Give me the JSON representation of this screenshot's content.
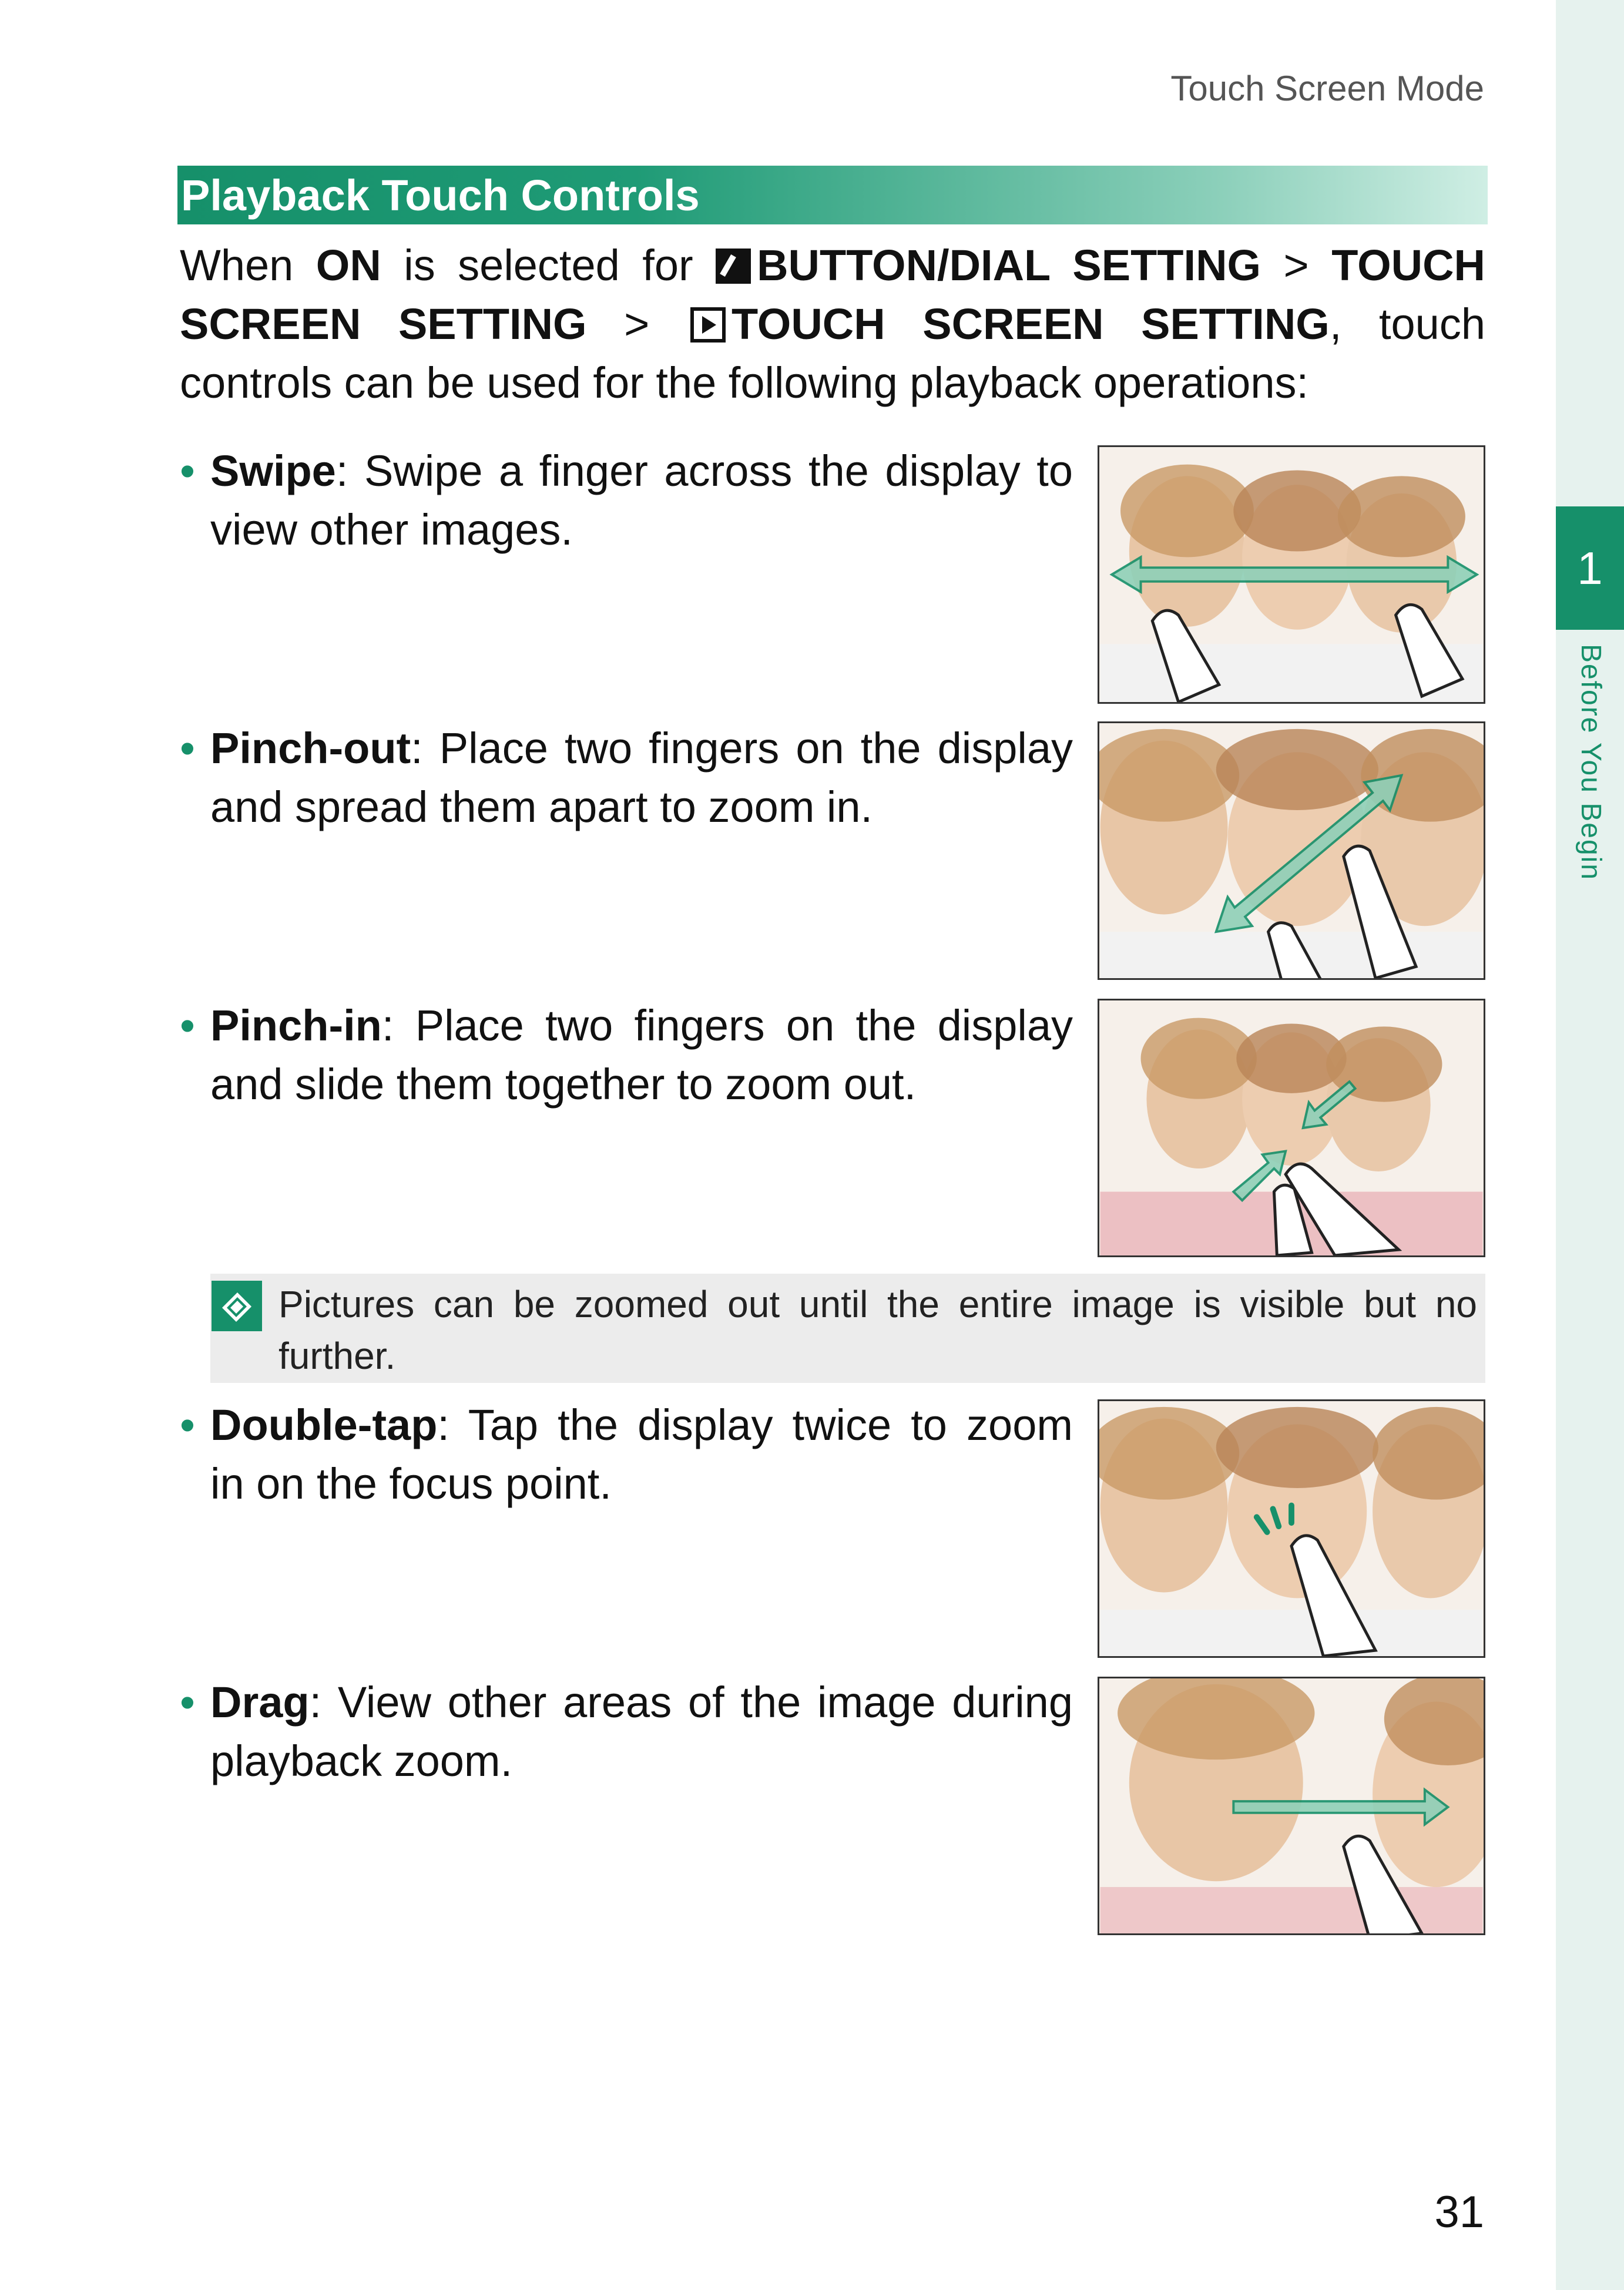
{
  "header": {
    "running_head": "Touch Screen Mode"
  },
  "side": {
    "chapter_number": "1",
    "chapter_title": "Before You Begin"
  },
  "section": {
    "title": "Playback Touch Controls"
  },
  "intro": {
    "t1": "When ",
    "t2": "ON",
    "t3": " is selected for ",
    "t4": "BUTTON/DIAL SETTING",
    "t5": " > ",
    "t6": "TOUCH SCREEN SETTING",
    "t7": " > ",
    "t8": "TOUCH SCREEN SETTING",
    "t9": ", touch controls can be used for the following playback operations:"
  },
  "items": [
    {
      "bullet": "•",
      "term": "Swipe",
      "text": ": Swipe a finger across the display to view other images."
    },
    {
      "bullet": "•",
      "term": "Pinch-out",
      "text": ": Place two fingers on the display and spread them apart to zoom in."
    },
    {
      "bullet": "•",
      "term": "Pinch-in",
      "text": ": Place two fingers on the display and slide them together to zoom out."
    },
    {
      "bullet": "•",
      "term": "Double-tap",
      "text": ": Tap the display twice to zoom in on the focus point."
    },
    {
      "bullet": "•",
      "term": "Drag",
      "text": ": View other areas of the image during playback zoom."
    }
  ],
  "note": {
    "text": "Pictures can be zoomed out until the entire image is visible but no further."
  },
  "footer": {
    "page_number": "31"
  },
  "colors": {
    "accent": "#16906a",
    "side_band": "#e6f2ee",
    "note_bg": "#ececec"
  },
  "icons": [
    "menu-setting-icon",
    "playback-icon",
    "note-icon"
  ]
}
